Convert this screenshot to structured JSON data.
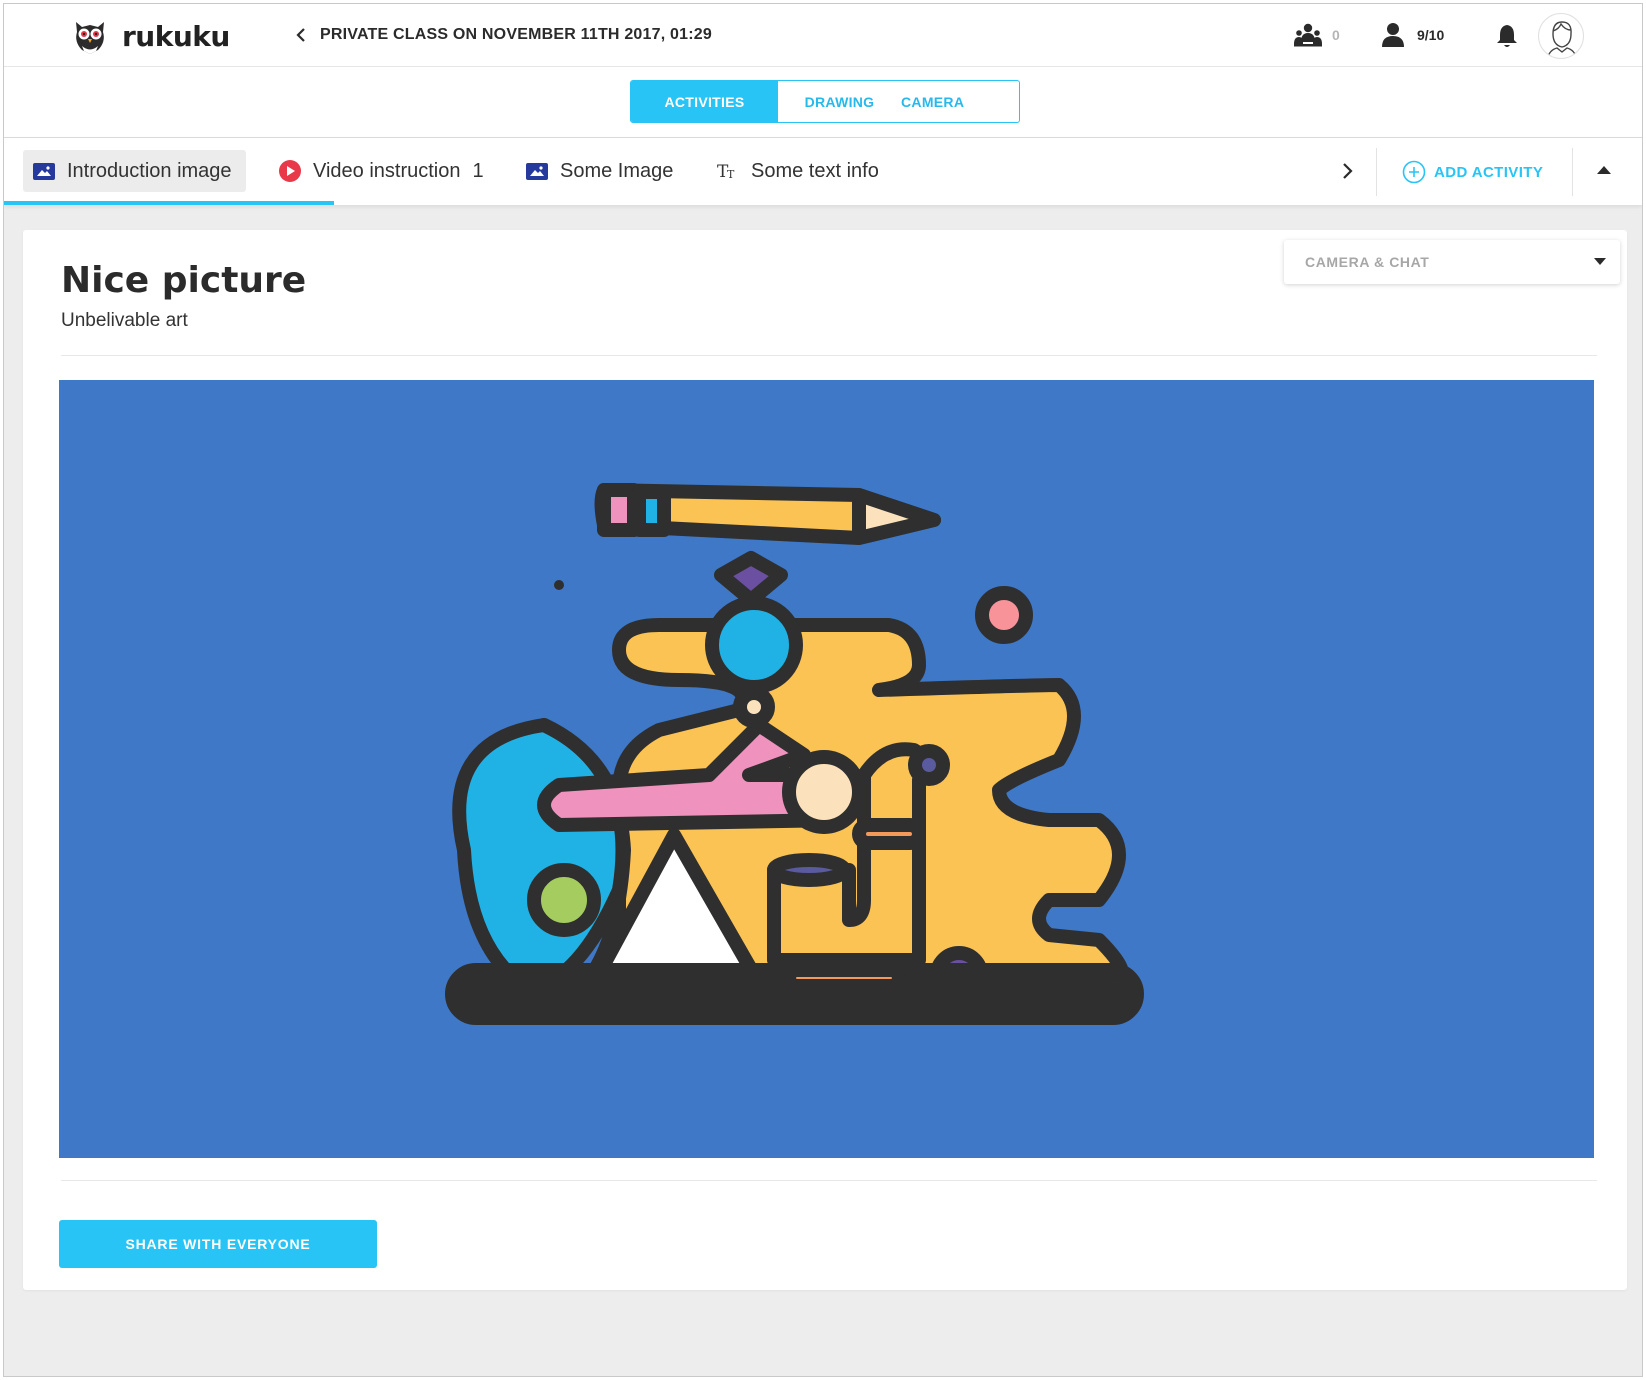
{
  "app": {
    "name": "rukuku"
  },
  "header": {
    "class_title": "PRIVATE CLASS ON NOVEMBER 11TH 2017, 01:29",
    "groups_count": "0",
    "students_count": "9/10"
  },
  "mode_tabs": [
    {
      "label": "ACTIVITIES",
      "active": true
    },
    {
      "label": "DRAWING",
      "active": false
    },
    {
      "label": "CAMERA",
      "active": false
    }
  ],
  "activities": [
    {
      "label": "Introduction image",
      "icon": "image-icon",
      "selected": true
    },
    {
      "label": "Video instruction",
      "icon": "play-icon",
      "badge": "1"
    },
    {
      "label": "Some Image",
      "icon": "image-icon"
    },
    {
      "label": "Some text info",
      "icon": "text-icon"
    }
  ],
  "toolbar": {
    "add_activity_label": "ADD ACTIVITY"
  },
  "content": {
    "title": "Nice picture",
    "subtitle": "Unbelivable art",
    "view_select": "CAMERA & CHAT",
    "share_label": "SHARE WITH EVERYONE"
  },
  "colors": {
    "accent": "#27c4f5",
    "image_background": "#3e78c7",
    "video_icon": "#e8384a",
    "image_icon": "#253a9c"
  }
}
